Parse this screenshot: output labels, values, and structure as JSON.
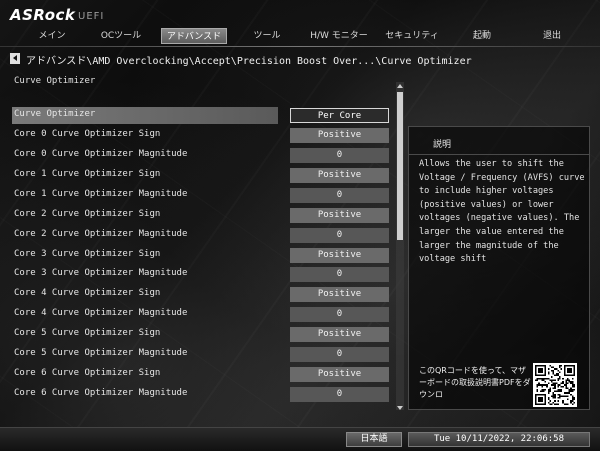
{
  "brand": {
    "logo": "ASRock",
    "sub": "UEFI"
  },
  "tabs": [
    {
      "label": "メイン"
    },
    {
      "label": "OCツール"
    },
    {
      "label": "アドバンスド"
    },
    {
      "label": "ツール"
    },
    {
      "label": "H/W モニター"
    },
    {
      "label": "セキュリティ"
    },
    {
      "label": "起動"
    },
    {
      "label": "退出"
    }
  ],
  "active_tab": "アドバンスド",
  "breadcrumb": "アドバンスド\\AMD Overclocking\\Accept\\Precision Boost Over...\\Curve Optimizer",
  "page_title": "Curve Optimizer",
  "settings": [
    {
      "label": "Curve Optimizer",
      "value": "Per Core"
    },
    {
      "label": "Core 0 Curve Optimizer Sign",
      "value": "Positive"
    },
    {
      "label": "Core 0 Curve Optimizer Magnitude",
      "value": "0"
    },
    {
      "label": "Core 1 Curve Optimizer Sign",
      "value": "Positive"
    },
    {
      "label": "Core 1 Curve Optimizer Magnitude",
      "value": "0"
    },
    {
      "label": "Core 2 Curve Optimizer Sign",
      "value": "Positive"
    },
    {
      "label": "Core 2 Curve Optimizer Magnitude",
      "value": "0"
    },
    {
      "label": "Core 3 Curve Optimizer Sign",
      "value": "Positive"
    },
    {
      "label": "Core 3 Curve Optimizer Magnitude",
      "value": "0"
    },
    {
      "label": "Core 4 Curve Optimizer Sign",
      "value": "Positive"
    },
    {
      "label": "Core 4 Curve Optimizer Magnitude",
      "value": "0"
    },
    {
      "label": "Core 5 Curve Optimizer Sign",
      "value": "Positive"
    },
    {
      "label": "Core 5 Curve Optimizer Magnitude",
      "value": "0"
    },
    {
      "label": "Core 6 Curve Optimizer Sign",
      "value": "Positive"
    },
    {
      "label": "Core 6 Curve Optimizer Magnitude",
      "value": "0"
    }
  ],
  "description": {
    "title": "説明",
    "text": "Allows the user to shift the Voltage / Frequency (AVFS) curve to include higher voltages (positive values) or lower voltages (negative values). The larger the value entered the larger the magnitude of the voltage shift",
    "qr_text": "このQRコードを使って、マザーボードの取扱説明書PDFをダウンロ"
  },
  "footer": {
    "language": "日本語",
    "datetime": "Tue 10/11/2022, 22:06:58"
  }
}
